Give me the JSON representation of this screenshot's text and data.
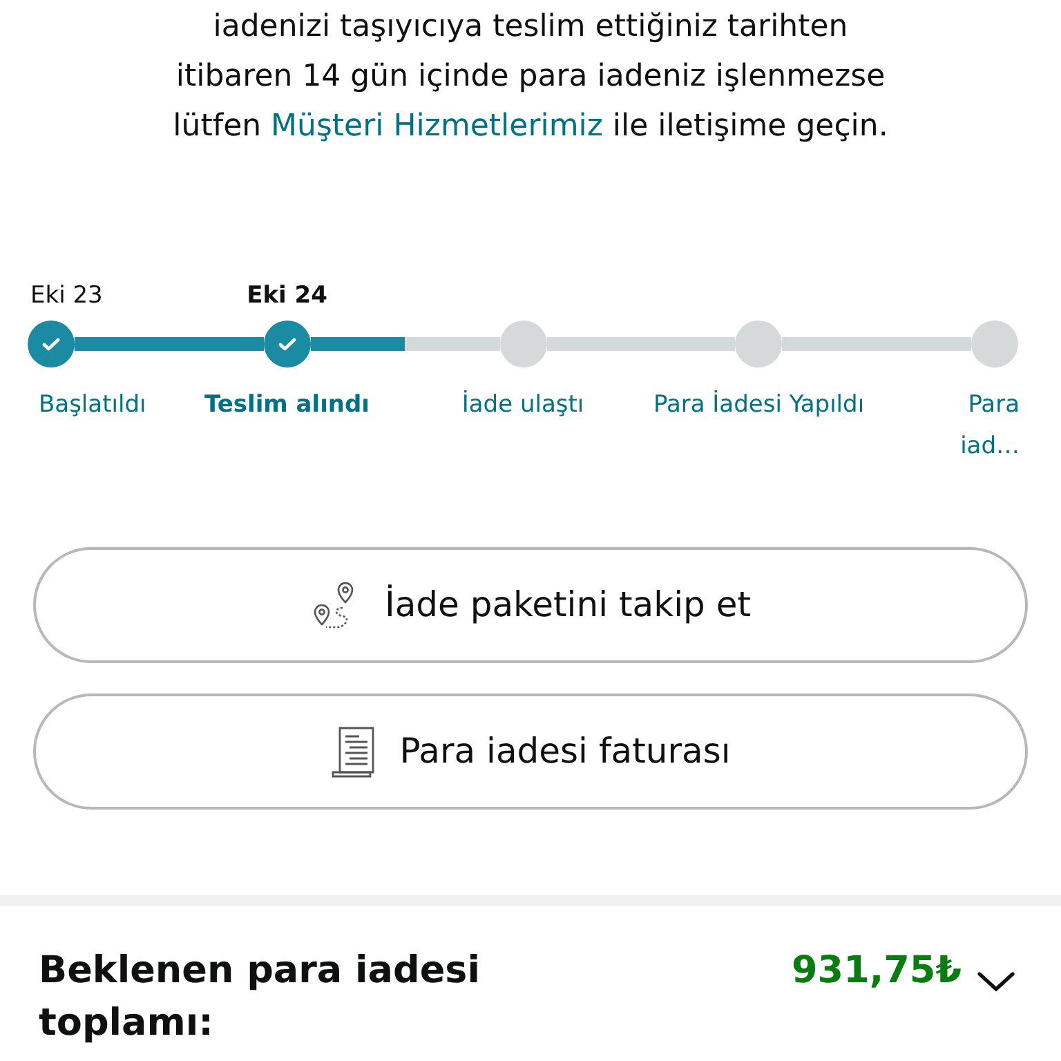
{
  "notice": {
    "before": "iadenizi taşıyıcıya teslim ettiğiniz tarihten itibaren 14 gün içinde para iadeniz işlenmezse lütfen",
    "link": "Müşteri Hizmetlerimiz",
    "after": "ile iletişime geçin."
  },
  "tracker": {
    "steps": [
      {
        "date": "Eki 23",
        "label": "Başlatıldı",
        "completed": true,
        "current": false
      },
      {
        "date": "Eki 24",
        "label": "Teslim alındı",
        "completed": true,
        "current": true
      },
      {
        "label": "İade ulaştı",
        "completed": false,
        "current": false
      },
      {
        "label": "Para İadesi Yapıldı",
        "completed": false,
        "current": false
      },
      {
        "label": "Para iad…",
        "completed": false,
        "current": false
      }
    ]
  },
  "buttons": [
    {
      "kind": "track",
      "label": "İade paketini takip et"
    },
    {
      "kind": "invoice",
      "label": "Para iadesi faturası"
    }
  ],
  "summary": {
    "label": "Beklenen para iadesi toplamı:",
    "amount": "931,75₺",
    "expanded": false
  }
}
